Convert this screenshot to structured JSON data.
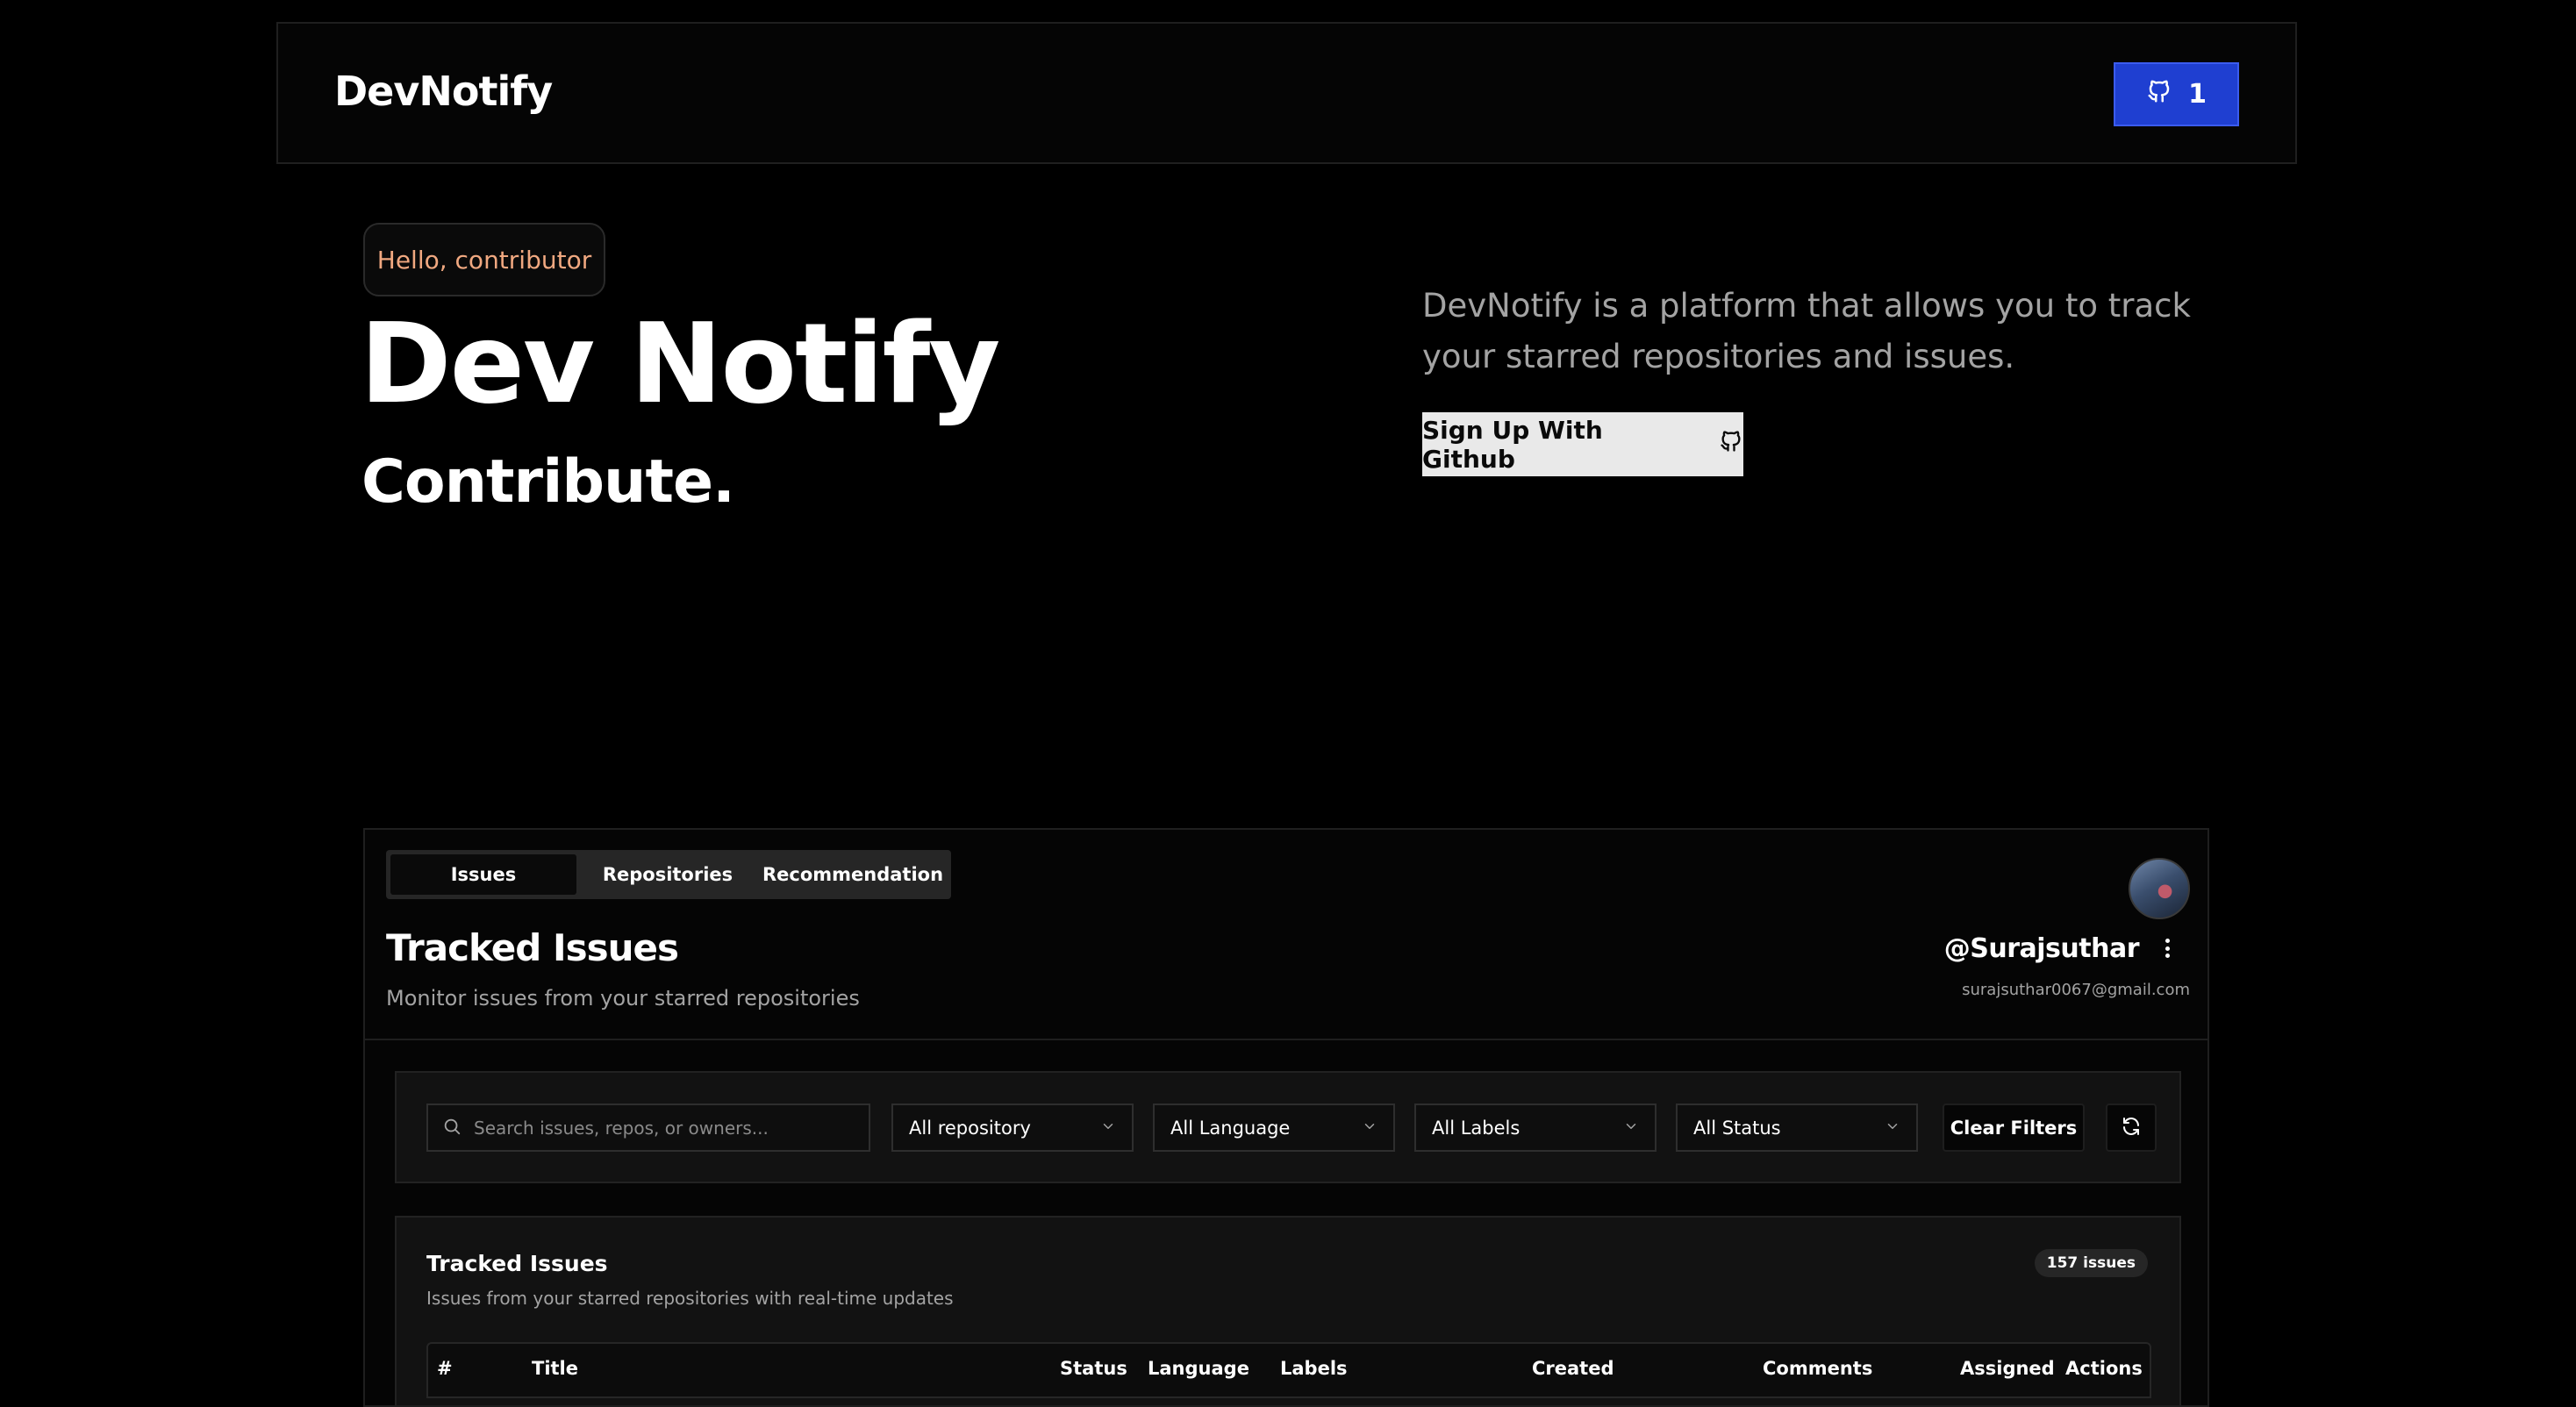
{
  "navbar": {
    "brand": "DevNotify",
    "github_button_count": "1"
  },
  "hero": {
    "greeting": "Hello, contributor",
    "title": "Dev Notify",
    "subtitle": "Contribute.",
    "description": "DevNotify is a platform that allows you to track your starred repositories and issues.",
    "signup_label": "Sign Up With Github"
  },
  "dashboard": {
    "tabs": [
      {
        "label": "Issues",
        "active": true
      },
      {
        "label": "Repositories",
        "active": false
      },
      {
        "label": "Recommendation",
        "active": false
      }
    ],
    "title": "Tracked Issues",
    "subtitle": "Monitor issues from your starred repositories",
    "user": {
      "username": "@Surajsuthar",
      "email": "surajsuthar0067@gmail.com"
    },
    "filters": {
      "search_placeholder": "Search issues, repos, or owners...",
      "repository": "All repository",
      "language": "All Language",
      "labels": "All Labels",
      "status": "All Status",
      "clear_label": "Clear Filters"
    },
    "issues_card": {
      "title": "Tracked Issues",
      "subtitle": "Issues from your starred repositories with real-time updates",
      "count": "157 issues",
      "columns": [
        "#",
        "Title",
        "Status",
        "Language",
        "Labels",
        "Created",
        "Comments",
        "Assigned",
        "Actions"
      ]
    }
  },
  "colors": {
    "background": "#000000",
    "accent_blue": "#1f3fd1",
    "greeting_orange": "#f0a880",
    "muted_text": "#a3a3a3"
  },
  "icons": [
    "github-icon",
    "search-icon",
    "chevron-down-icon",
    "refresh-icon",
    "more-vertical-icon"
  ]
}
